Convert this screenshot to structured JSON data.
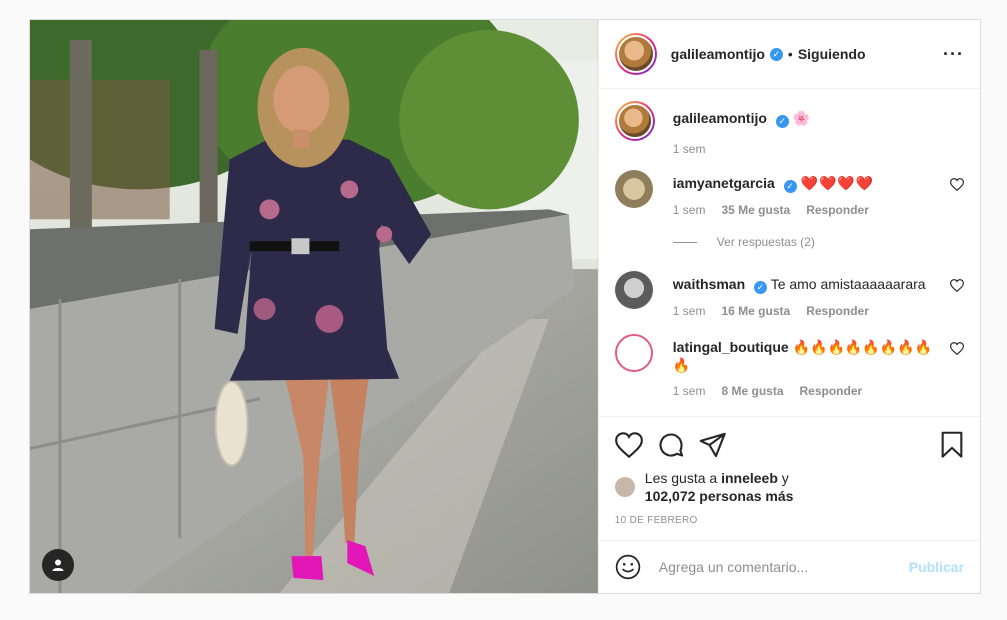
{
  "post": {
    "author": "galileamontijo",
    "follow_status": "Siguiendo",
    "more_icon": "more-options-icon",
    "caption": {
      "username": "galileamontijo",
      "emoji": "🌸",
      "time": "1 sem"
    },
    "comments": [
      {
        "username": "iamyanetgarcia",
        "text": "❤️❤️❤️❤️",
        "time": "1 sem",
        "likes": "35 Me gusta",
        "reply": "Responder",
        "view_replies": "Ver respuestas (2)"
      },
      {
        "username": "waithsman",
        "text": "Te amo amistaaaaaarara",
        "time": "1 sem",
        "likes": "16 Me gusta",
        "reply": "Responder"
      },
      {
        "username": "latingal_boutique",
        "text": "🔥🔥🔥🔥🔥🔥🔥🔥🔥",
        "time": "1 sem",
        "likes": "8 Me gusta",
        "reply": "Responder"
      }
    ],
    "likes_text_prefix": "Les gusta a",
    "likes_user": "inneleeb",
    "likes_text_mid": "y",
    "likes_count": "102,072 personas más",
    "date": "10 DE FEBRERO",
    "comment_placeholder": "Agrega un comentario...",
    "publish_label": "Publicar"
  },
  "colors": {
    "accent": "#3897f0",
    "publish_disabled": "#b2dffc",
    "heart": "#e0242e"
  }
}
